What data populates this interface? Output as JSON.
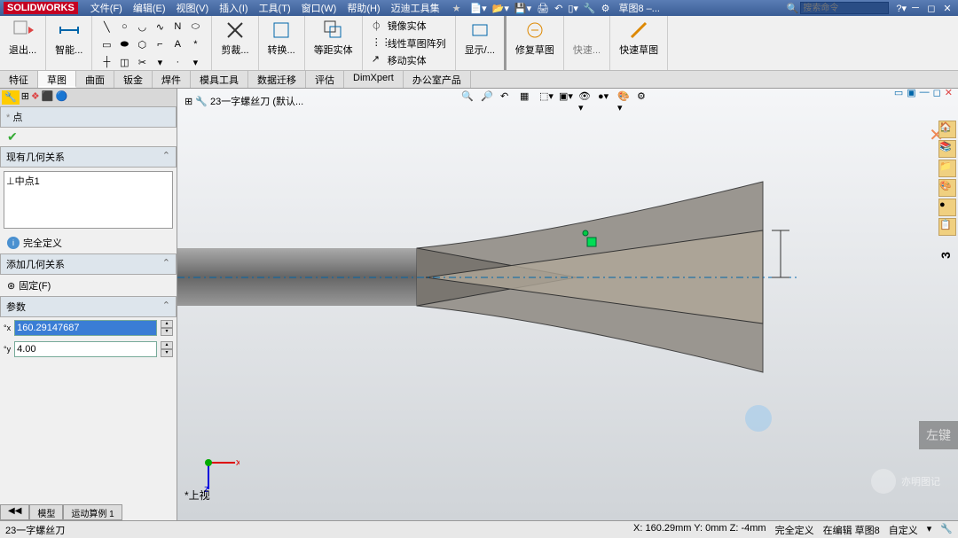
{
  "app": {
    "name": "SOLIDWORKS"
  },
  "menus": [
    "文件(F)",
    "编辑(E)",
    "视图(V)",
    "插入(I)",
    "工具(T)",
    "窗口(W)",
    "帮助(H)",
    "迈迪工具集"
  ],
  "title_doc": "草图8 –...",
  "search_placeholder": "搜索命令",
  "ribbon": {
    "exit": "退出...",
    "smart": "智能...",
    "trim": "剪裁...",
    "convert": "转换...",
    "offset": "等距实体",
    "mirror": "镜像实体",
    "linear_pattern": "线性草图阵列",
    "move": "移动实体",
    "display": "显示/...",
    "repair": "修复草图",
    "quick": "快速...",
    "quick_sketch": "快速草图"
  },
  "tabs": [
    "特征",
    "草图",
    "曲面",
    "钣金",
    "焊件",
    "模具工具",
    "数据迁移",
    "评估",
    "DimXpert",
    "办公室产品"
  ],
  "active_tab": "草图",
  "doc_tree": "23一字螺丝刀  (默认...",
  "point_panel": {
    "title": "点",
    "existing_rel": "现有几何关系",
    "relation1": "中点1",
    "fully_defined": "完全定义",
    "add_rel": "添加几何关系",
    "fixed": "固定(F)",
    "params": "参数",
    "x_val": "160.29147687",
    "y_val": "4.00"
  },
  "view_name": "*上视",
  "dimension": "3",
  "bottom_tabs": [
    "模型",
    "运动算例 1"
  ],
  "status": {
    "doc": "23一字螺丝刀",
    "coords": "X: 160.29mm Y: 0mm Z: -4mm",
    "state": "完全定义",
    "editing": "在编辑 草图8",
    "custom": "自定义"
  },
  "hint": "左键",
  "watermark": "亦明图记",
  "icons": {
    "line": "╲",
    "rect": "▭",
    "circle": "○",
    "arc": "◡",
    "spline": "∿",
    "ellipse": "⬭",
    "point": "·",
    "text": "A",
    "fillet": "⌐",
    "plane": "◫"
  }
}
